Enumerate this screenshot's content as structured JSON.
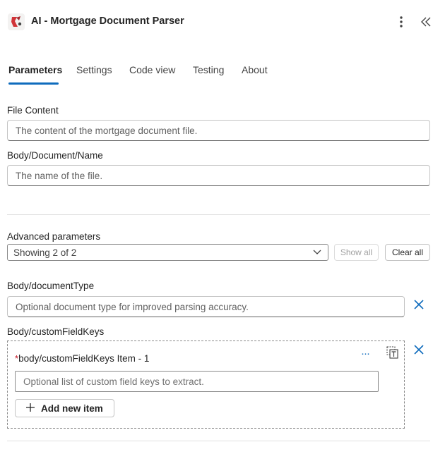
{
  "header": {
    "title": "AI - Mortgage Document Parser",
    "icon": "app-logo-icon",
    "accent_color": "#d13438"
  },
  "tabs": [
    {
      "label": "Parameters",
      "active": true
    },
    {
      "label": "Settings",
      "active": false
    },
    {
      "label": "Code view",
      "active": false
    },
    {
      "label": "Testing",
      "active": false
    },
    {
      "label": "About",
      "active": false
    }
  ],
  "fields": {
    "file_content": {
      "label": "File Content",
      "placeholder": "The content of the mortgage document file."
    },
    "document_name": {
      "label": "Body/Document/Name",
      "placeholder": "The name of the file."
    }
  },
  "advanced": {
    "label": "Advanced parameters",
    "select_value": "Showing 2 of 2",
    "show_all": "Show all",
    "clear_all": "Clear all"
  },
  "document_type": {
    "label": "Body/documentType",
    "placeholder": "Optional document type for improved parsing accuracy."
  },
  "custom_field_keys": {
    "label": "Body/customFieldKeys",
    "item_label": "body/customFieldKeys Item - 1",
    "item_required_mark": "*",
    "item_placeholder": "Optional list of custom field keys to extract.",
    "more_label": "···",
    "add_item": "Add new item"
  },
  "colors": {
    "primary": "#0f6cbd",
    "remove": "#0f6cbd",
    "required": "#c50f1f"
  }
}
